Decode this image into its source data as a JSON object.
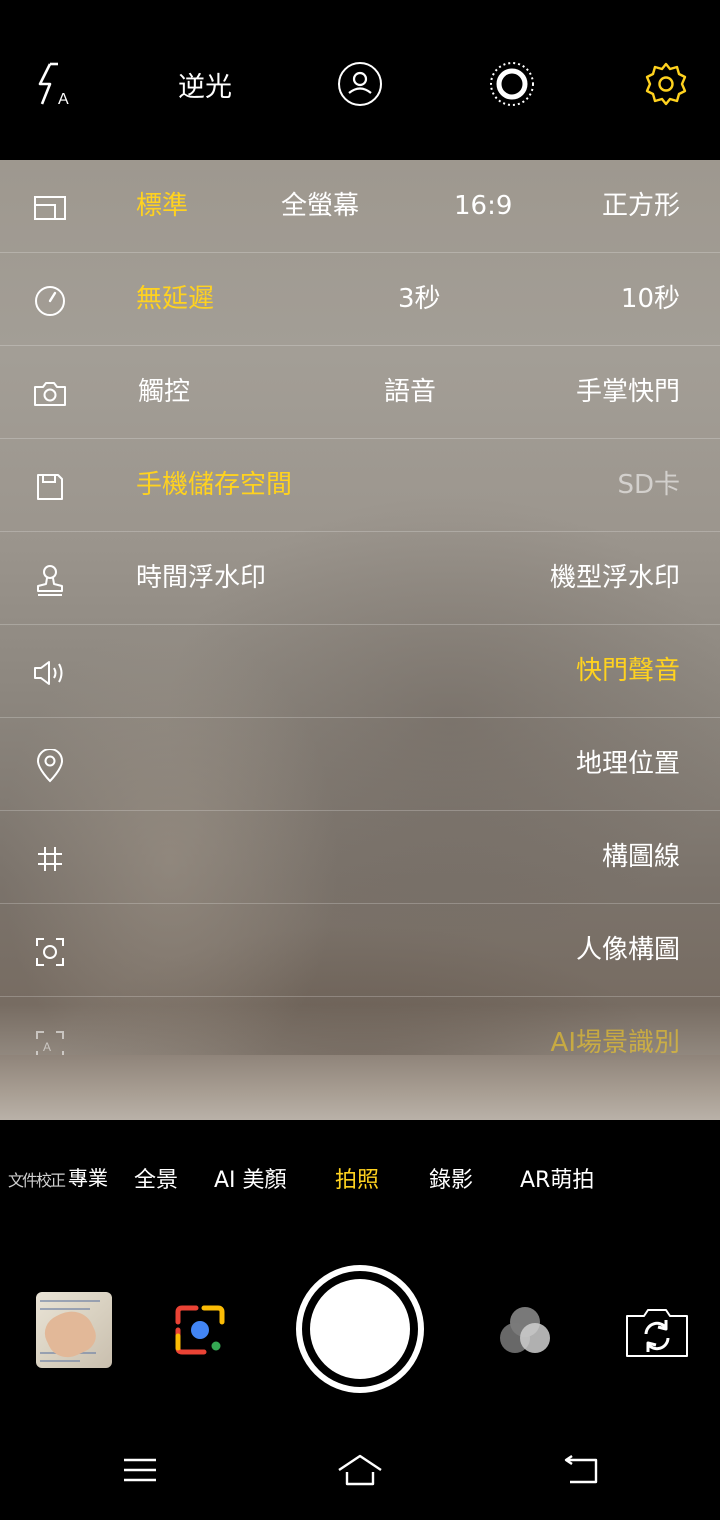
{
  "top_bar": {
    "flash_icon": "flash-auto-icon",
    "hdr_label": "逆光",
    "portrait_icon": "portrait-mode-icon",
    "live_icon": "live-photo-icon",
    "settings_icon": "gear-icon"
  },
  "settings_panel": {
    "rows": [
      {
        "icon": "aspect-ratio-icon",
        "options": [
          "標準",
          "全螢幕",
          "16:9",
          "正方形"
        ],
        "selected": "標準"
      },
      {
        "icon": "timer-icon",
        "options": [
          "無延遲",
          "3秒",
          "10秒"
        ],
        "selected": "無延遲"
      },
      {
        "icon": "camera-icon",
        "options": [
          "觸控",
          "語音",
          "手掌快門"
        ],
        "selected": ""
      },
      {
        "icon": "storage-icon",
        "options": [
          "手機儲存空間",
          "SD卡"
        ],
        "selected": "手機儲存空間",
        "disabled": "SD卡"
      },
      {
        "icon": "stamp-icon",
        "options": [
          "時間浮水印",
          "機型浮水印"
        ],
        "selected": ""
      },
      {
        "icon": "speaker-icon",
        "options": [
          "快門聲音"
        ],
        "selected": "快門聲音"
      },
      {
        "icon": "location-pin-icon",
        "options": [
          "地理位置"
        ],
        "selected": ""
      },
      {
        "icon": "grid-icon",
        "options": [
          "構圖線"
        ],
        "selected": ""
      },
      {
        "icon": "face-frame-icon",
        "options": [
          "人像構圖"
        ],
        "selected": ""
      },
      {
        "icon": "ai-scene-icon",
        "options": [
          "AI場景識別"
        ],
        "selected": "AI場景識別"
      }
    ]
  },
  "modes": {
    "items": [
      "文件校正",
      "專業",
      "全景",
      "AI 美顏",
      "拍照",
      "錄影",
      "AR萌拍"
    ],
    "selected": "拍照"
  },
  "controls": {
    "gallery_thumbnail": "gallery-thumbnail",
    "lens_icon": "google-lens-icon",
    "shutter": "shutter-button",
    "filters_icon": "filters-icon",
    "switch_camera_icon": "switch-camera-icon"
  },
  "nav": {
    "menu_icon": "menu-icon",
    "home_icon": "home-icon",
    "back_icon": "back-icon"
  },
  "colors": {
    "accent": "#ffd21f",
    "background": "#000000",
    "text": "#ffffff"
  }
}
